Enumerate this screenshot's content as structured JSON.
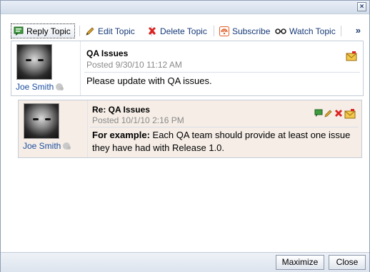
{
  "window": {
    "close_glyph": "×"
  },
  "toolbar": {
    "items": [
      {
        "label": "Reply Topic",
        "icon": "reply-icon"
      },
      {
        "label": "Edit Topic",
        "icon": "pencil-icon"
      },
      {
        "label": "Delete Topic",
        "icon": "delete-x-icon"
      },
      {
        "label": "Subscribe",
        "icon": "rss-icon"
      },
      {
        "label": "Watch Topic",
        "icon": "glasses-icon"
      }
    ],
    "more_label": "»"
  },
  "posts": [
    {
      "author": "Joe Smith",
      "subject": "QA Issues",
      "posted": "Posted 9/30/10 11:12 AM",
      "body": "Please update with QA issues."
    },
    {
      "author": "Joe Smith",
      "subject": "Re: QA Issues",
      "posted": "Posted 10/1/10 2:16 PM",
      "body_bold": "For example:",
      "body": " Each QA team should provide at least one issue they have had with Release 1.0."
    }
  ],
  "footer": {
    "maximize_label": "Maximize",
    "close_label": "Close"
  },
  "colors": {
    "accent": "#173a78",
    "link": "#1d4fa0",
    "reply_bg": "#f5ede6"
  }
}
